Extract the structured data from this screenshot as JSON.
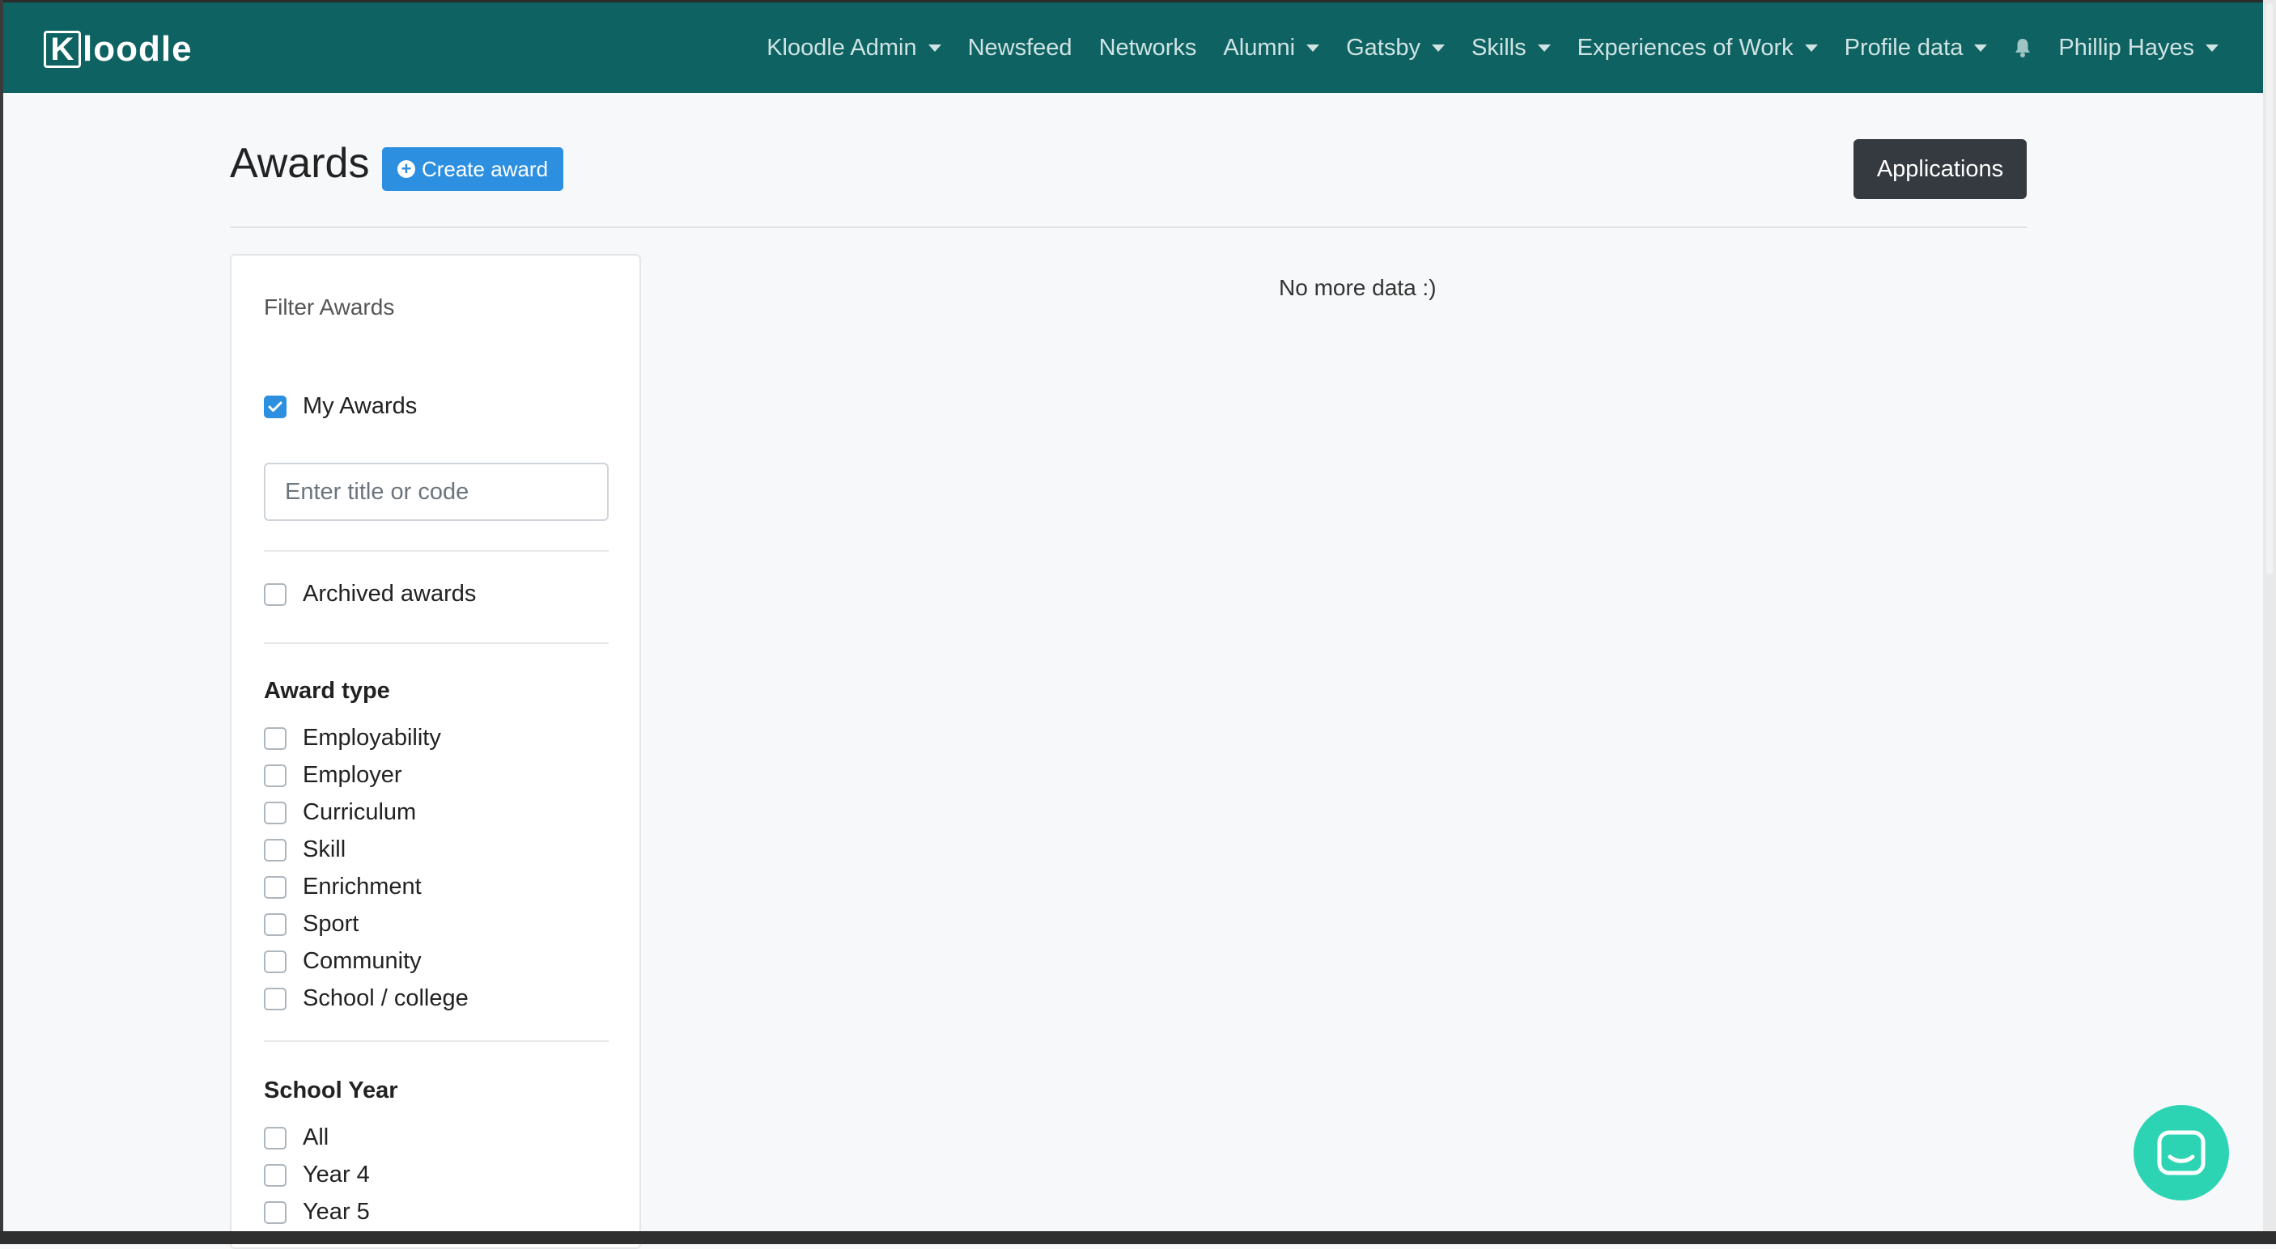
{
  "brand": {
    "k": "K",
    "rest": "loodle"
  },
  "nav": {
    "items": [
      {
        "label": "Kloodle Admin",
        "dropdown": true
      },
      {
        "label": "Newsfeed",
        "dropdown": false
      },
      {
        "label": "Networks",
        "dropdown": false
      },
      {
        "label": "Alumni",
        "dropdown": true
      },
      {
        "label": "Gatsby",
        "dropdown": true
      },
      {
        "label": "Skills",
        "dropdown": true
      },
      {
        "label": "Experiences of Work",
        "dropdown": true
      },
      {
        "label": "Profile data",
        "dropdown": true
      }
    ],
    "user": {
      "label": "Phillip Hayes",
      "dropdown": true
    },
    "bell_icon": "bell-icon"
  },
  "page": {
    "title": "Awards",
    "create_button": "Create award",
    "applications_button": "Applications",
    "empty_message": "No more data :)"
  },
  "filter": {
    "title": "Filter Awards",
    "my_awards": {
      "label": "My Awards",
      "checked": true
    },
    "search_placeholder": "Enter title or code",
    "archived": {
      "label": "Archived awards",
      "checked": false
    },
    "award_type": {
      "title": "Award type",
      "options": [
        "Employability",
        "Employer",
        "Curriculum",
        "Skill",
        "Enrichment",
        "Sport",
        "Community",
        "School / college"
      ]
    },
    "school_year": {
      "title": "School Year",
      "options": [
        "All",
        "Year 4",
        "Year 5"
      ]
    }
  },
  "colors": {
    "navbar": "#0e6262",
    "primary": "#2d8fe0",
    "dark_button": "#343a40",
    "chat": "#2dd4b4"
  }
}
